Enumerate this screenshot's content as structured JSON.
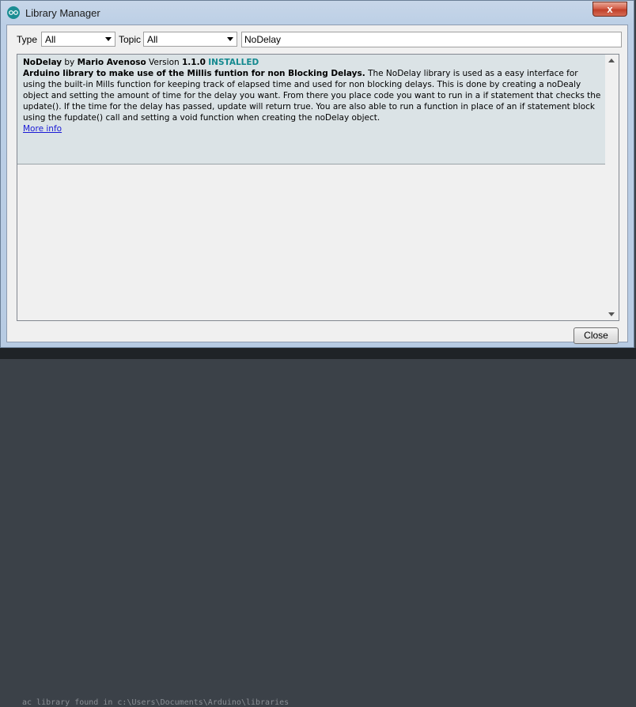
{
  "window": {
    "title": "Library Manager",
    "close_glyph": "x"
  },
  "filters": {
    "type_label": "Type",
    "type_value": "All",
    "topic_label": "Topic",
    "topic_value": "All",
    "search_value": "NoDelay"
  },
  "library": {
    "name": "NoDelay",
    "by": "by",
    "author": "Mario Avenoso",
    "version_label": "Version",
    "version": "1.1.0",
    "status": "INSTALLED",
    "sentence": "Arduino library to make use of the Millis funtion for non Blocking Delays.",
    "paragraph": "The NoDelay library is used as a easy interface for using the built-in Mills function for keeping track of elapsed time and used for non blocking delays. This is done by creating a noDealy object and setting the amount of time for the delay you want. From there you place code you want to run in a if statement that checks the update(). If the time for the delay has passed, update will return true. You are also able to run a function in place of an if statement block using the fupdate() call and setting a void function when creating the noDelay object.",
    "more_info": "More info"
  },
  "buttons": {
    "close": "Close"
  },
  "background": {
    "text": "ac library found in c:\\Users\\Documents\\Arduino\\libraries"
  },
  "colors": {
    "installed": "#13898f",
    "link": "#1a1ad6",
    "entry_bg": "#dbe3e6"
  }
}
